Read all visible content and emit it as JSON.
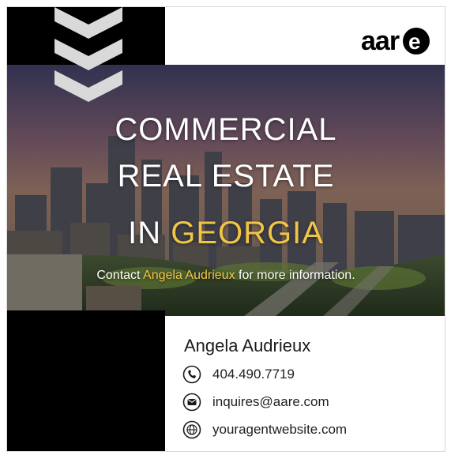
{
  "brand": {
    "logo_text": "aare"
  },
  "headline": {
    "line1": "COMMERCIAL",
    "line2": "REAL ESTATE",
    "line3_prefix": "IN ",
    "line3_highlight": "GEORGIA"
  },
  "contact_line": {
    "prefix": "Contact ",
    "name": "Angela Audrieux",
    "suffix": " for more information."
  },
  "agent": {
    "name": "Angela Audrieux",
    "phone": "404.490.7719",
    "email": "inquires@aare.com",
    "website": "youragentwebsite.com"
  },
  "icons": [
    "phone-icon",
    "mail-icon",
    "globe-icon"
  ],
  "colors": {
    "accent": "#f3c547",
    "black": "#000000",
    "chevron": "#d9d9d9"
  }
}
